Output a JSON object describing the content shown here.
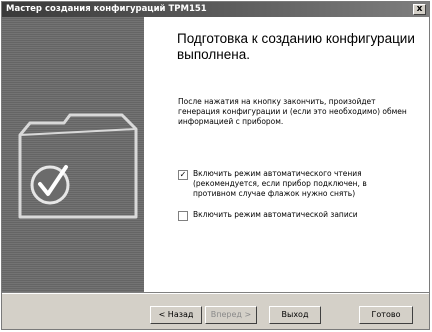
{
  "window": {
    "title": "Мастер создания конфигураций ТРМ151",
    "close_label": "x"
  },
  "main": {
    "heading": "Подготовка к созданию конфигурации выполнена.",
    "description": "После нажатия на кнопку закончить, произойдет генерация конфигурации и (если это необходимо) обмен информацией с прибором.",
    "options": [
      {
        "label": "Включить режим автоматического чтения (рекомендуется, если прибор подключен, в противном случае флажок нужно снять)",
        "checked": true
      },
      {
        "label": "Включить режим автоматической записи",
        "checked": false
      }
    ]
  },
  "buttons": {
    "back": "< Назад",
    "next": "Вперед >",
    "exit": "Выход",
    "finish": "Готово"
  },
  "sidebar": {
    "icon": "folder-checkmark-icon"
  }
}
